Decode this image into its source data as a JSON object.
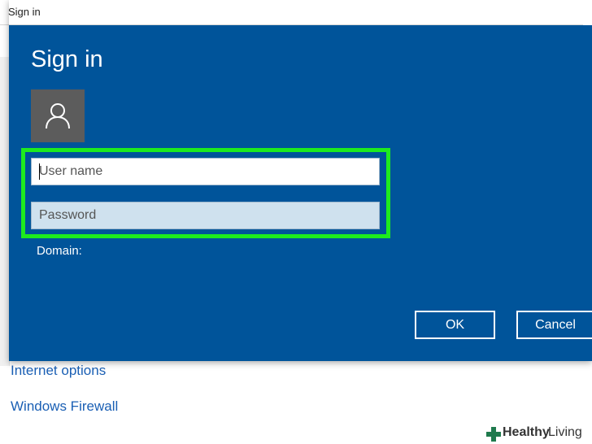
{
  "window": {
    "title": "Sign in"
  },
  "dialog": {
    "heading": "Sign in",
    "avatar_icon": "user-icon",
    "username": {
      "placeholder": "User name",
      "value": ""
    },
    "password": {
      "placeholder": "Password",
      "value": ""
    },
    "domain_label": "Domain:",
    "ok_label": "OK",
    "cancel_label": "Cancel",
    "highlight_color": "#1eeb1e",
    "background_color": "#00549a"
  },
  "background_links": [
    {
      "label": "Internet options"
    },
    {
      "label": "Windows Firewall"
    }
  ],
  "watermark": {
    "text_bold": "Healthy",
    "text_regular": "Living"
  }
}
